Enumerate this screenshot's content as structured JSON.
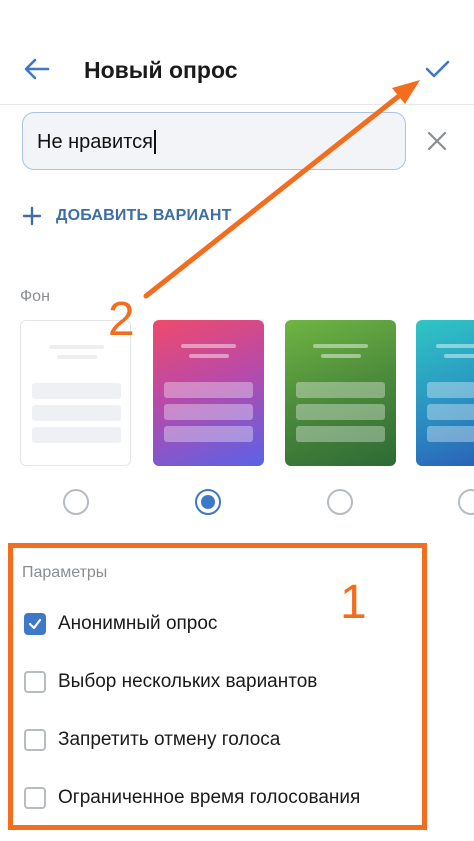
{
  "header": {
    "title": "Новый опрос",
    "back_icon": "arrow-left-icon",
    "confirm_icon": "checkmark-icon"
  },
  "option_input": {
    "value": "Не нравится",
    "clear_icon": "close-icon"
  },
  "add_option": {
    "label": "ДОБАВИТЬ ВАРИАНТ",
    "icon": "plus-icon"
  },
  "background": {
    "label": "Фон",
    "selected_index": 1,
    "tiles": [
      {
        "name": "white"
      },
      {
        "name": "pink-purple-gradient"
      },
      {
        "name": "green-gradient"
      },
      {
        "name": "teal-blue-gradient"
      }
    ]
  },
  "params": {
    "title": "Параметры",
    "items": [
      {
        "label": "Анонимный опрос",
        "checked": true
      },
      {
        "label": "Выбор нескольких вариантов",
        "checked": false
      },
      {
        "label": "Запретить отмену голоса",
        "checked": false
      },
      {
        "label": "Ограниченное время голосования",
        "checked": false
      }
    ]
  },
  "annotations": {
    "step1": "1",
    "step2": "2",
    "color": "#f36d1e"
  },
  "colors": {
    "accent": "#3e78c9",
    "link": "#3f6ea2"
  }
}
